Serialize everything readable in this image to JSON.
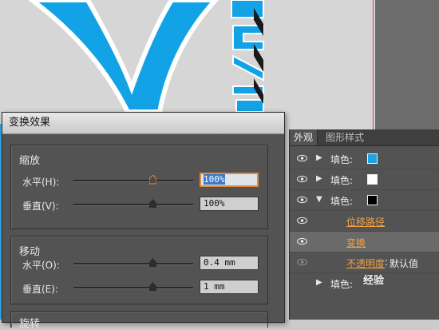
{
  "dialog": {
    "title": "变换效果",
    "scale": {
      "title": "缩放",
      "horizontal": {
        "label": "水平(H):",
        "value": "100%",
        "level": 0.66
      },
      "vertical": {
        "label": "垂直(V):",
        "value": "100%",
        "level": 0.66
      }
    },
    "move": {
      "title": "移动",
      "horizontal": {
        "label": "水平(O):",
        "value": "0.4 mm",
        "level": 0.66
      },
      "vertical": {
        "label": "垂直(E):",
        "value": "1 mm",
        "level": 0.66
      }
    },
    "rotate": {
      "title": "旋转"
    }
  },
  "panel": {
    "tabs": [
      "外观",
      "图形样式"
    ],
    "rows": [
      {
        "label": "填色:",
        "swatch": "#1ea3e0",
        "expanded": false
      },
      {
        "label": "填色:",
        "swatch": "#ffffff",
        "expanded": false
      },
      {
        "label": "填色:",
        "swatch": "#000000",
        "expanded": true
      },
      {
        "effect": "位移路径"
      },
      {
        "effect": "变换"
      },
      {
        "effect": "不透明度",
        "value": "默认值"
      },
      {
        "label": "填色:"
      }
    ]
  },
  "canvas": {
    "logo_color": "#12a2e6",
    "guide_color": "#e0383e"
  },
  "watermark": "经验"
}
